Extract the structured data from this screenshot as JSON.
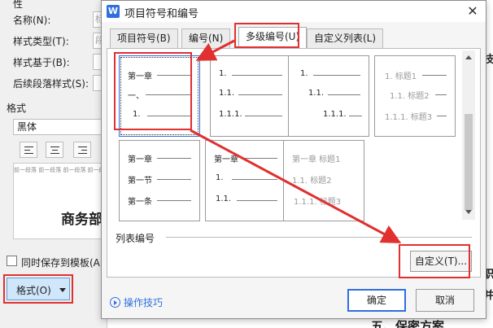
{
  "style_dialog": {
    "section_top": "性",
    "name_label": "名称(N):",
    "name_value": "标",
    "style_type_label": "样式类型(T):",
    "style_type_value": "段",
    "based_on_label": "样式基于(B):",
    "next_style_label": "后续段落样式(S):",
    "format_section": "格式",
    "font_value": "黑体",
    "preview_small_text": "前一段落 前一段落 前一段落 前一段落 前一段落 前一段落 前一段落 前一段落 前一段落",
    "preview_big_text": "商务部",
    "save_template_label": "同时保存到模板(A)",
    "format_button": "格式(O)"
  },
  "document": {
    "right_chars": [
      "技",
      "职",
      "并"
    ],
    "bottom_heading": "五、保密方案"
  },
  "dialog": {
    "title": "项目符号和编号",
    "app_icon_letter": "W",
    "close_glyph": "✕",
    "tabs": [
      {
        "label": "项目符号(B)",
        "active": false
      },
      {
        "label": "编号(N)",
        "active": false
      },
      {
        "label": "多级编号(U)",
        "active": true
      },
      {
        "label": "自定义列表(L)",
        "active": false
      }
    ],
    "cells": [
      {
        "lines": [
          "第一章",
          "一、",
          "1."
        ]
      },
      {
        "lines": [
          "1.",
          "1.1.",
          "1.1.1."
        ]
      },
      {
        "lines": [
          "1.",
          "1.1.",
          "1.1.1."
        ]
      },
      {
        "lines": [
          "1. 标题1",
          "1.1. 标题2",
          "1.1.1. 标题3"
        ]
      },
      {
        "lines": [
          "第一章",
          "第一节",
          "第一条"
        ]
      },
      {
        "lines": [
          "第一章",
          "1.",
          "1.1."
        ]
      },
      {
        "lines": [
          "第一章 标题1",
          "1.1. 标题2",
          "1.1.1. 标题3"
        ]
      }
    ],
    "list_label": "列表编号",
    "custom_button": "自定义(T)...",
    "tips_link": "操作技巧",
    "ok_button": "确定",
    "cancel_button": "取消"
  },
  "colors": {
    "highlight": "#e03030",
    "accent": "#2f6fe0"
  }
}
